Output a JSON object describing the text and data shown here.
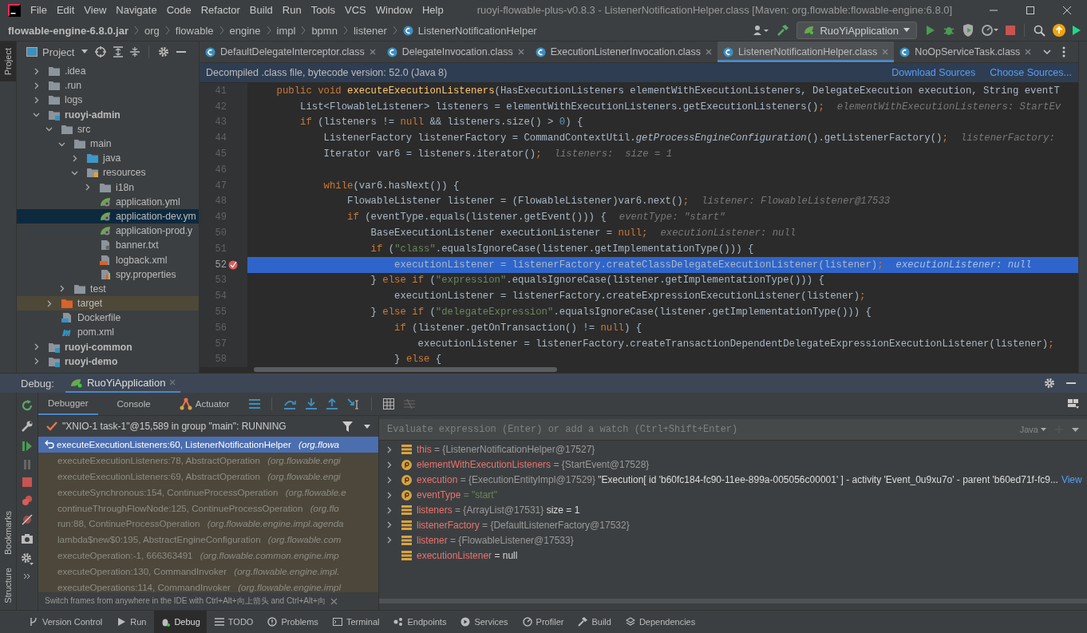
{
  "menu": [
    "File",
    "Edit",
    "View",
    "Navigate",
    "Code",
    "Refactor",
    "Build",
    "Run",
    "Tools",
    "VCS",
    "Window",
    "Help"
  ],
  "window_title": "ruoyi-flowable-plus-v0.8.3 - ListenerNotificationHelper.class [Maven: org.flowable:flowable-engine:6.8.0]",
  "breadcrumbs": [
    "flowable-engine-6.8.0.jar",
    "org",
    "flowable",
    "engine",
    "impl",
    "bpmn",
    "listener",
    "ListenerNotificationHelper"
  ],
  "run_config": "RuoYiApplication",
  "left_stripe": [
    "Project",
    "Bookmarks",
    "Structure"
  ],
  "project": {
    "title": "Project",
    "tree": [
      {
        "label": ".idea",
        "kind": "folder",
        "expanded": false,
        "selected": false
      },
      {
        "label": ".run",
        "kind": "folder",
        "expanded": false,
        "selected": false
      },
      {
        "label": "logs",
        "kind": "folder",
        "expanded": false,
        "selected": false
      },
      {
        "label": "ruoyi-admin",
        "kind": "module",
        "expanded": true,
        "selected": false,
        "children": [
          {
            "label": "src",
            "kind": "folder",
            "expanded": true,
            "selected": false,
            "children": [
              {
                "label": "main",
                "kind": "folder",
                "expanded": true,
                "selected": false,
                "children": [
                  {
                    "label": "java",
                    "kind": "source",
                    "expanded": false,
                    "selected": false
                  },
                  {
                    "label": "resources",
                    "kind": "resources",
                    "expanded": true,
                    "selected": false,
                    "children": [
                      {
                        "label": "i18n",
                        "kind": "folder",
                        "expanded": false,
                        "selected": false
                      },
                      {
                        "label": "application.yml",
                        "kind": "yaml",
                        "selected": false
                      },
                      {
                        "label": "application-dev.ym",
                        "kind": "yaml",
                        "selected": true
                      },
                      {
                        "label": "application-prod.y",
                        "kind": "yaml",
                        "selected": false
                      },
                      {
                        "label": "banner.txt",
                        "kind": "text",
                        "selected": false
                      },
                      {
                        "label": "logback.xml",
                        "kind": "xml",
                        "selected": false
                      },
                      {
                        "label": "spy.properties",
                        "kind": "properties",
                        "selected": false
                      }
                    ]
                  }
                ]
              },
              {
                "label": "test",
                "kind": "folder",
                "expanded": false,
                "selected": false
              }
            ]
          },
          {
            "label": "target",
            "kind": "excluded",
            "expanded": false,
            "selected": false
          },
          {
            "label": "Dockerfile",
            "kind": "docker",
            "selected": false
          },
          {
            "label": "pom.xml",
            "kind": "maven",
            "selected": false
          }
        ]
      },
      {
        "label": "ruoyi-common",
        "kind": "module",
        "expanded": false,
        "selected": false
      },
      {
        "label": "ruoyi-demo",
        "kind": "module",
        "expanded": false,
        "selected": false
      }
    ]
  },
  "editor_tabs": [
    {
      "label": "DefaultDelegateInterceptor.class",
      "selected": false
    },
    {
      "label": "DelegateInvocation.class",
      "selected": false
    },
    {
      "label": "ExecutionListenerInvocation.class",
      "selected": false
    },
    {
      "label": "ListenerNotificationHelper.class",
      "selected": true
    },
    {
      "label": "NoOpServiceTask.class",
      "selected": false
    }
  ],
  "banner": {
    "text": "Decompiled .class file, bytecode version: 52.0 (Java 8)",
    "links": [
      "Download Sources",
      "Choose Sources..."
    ]
  },
  "code_lines": [
    {
      "number": "41",
      "current": false,
      "breakpoint": false,
      "segments": [
        {
          "kind": "keyword",
          "t": "    public void "
        },
        {
          "kind": "declaration",
          "t": "executeExecutionListeners"
        },
        {
          "kind": "plain",
          "t": "(HasExecutionListeners elementWithExecutionListeners, DelegateExecution execution, String eventT"
        }
      ]
    },
    {
      "number": "42",
      "current": false,
      "breakpoint": false,
      "segments": [
        {
          "kind": "plain",
          "t": "        List<FlowableListener> listeners = elementWithExecutionListeners.getExecutionListeners()"
        },
        {
          "kind": "keyword",
          "t": ";"
        },
        {
          "kind": "hint",
          "t": "elementWithExecutionListeners: StartEv"
        }
      ]
    },
    {
      "number": "43",
      "current": false,
      "breakpoint": false,
      "segments": [
        {
          "kind": "keyword",
          "t": "        if"
        },
        {
          "kind": "plain",
          "t": " (listeners != "
        },
        {
          "kind": "keyword",
          "t": "null"
        },
        {
          "kind": "plain",
          "t": " && listeners.size() > "
        },
        {
          "kind": "number",
          "t": "0"
        },
        {
          "kind": "plain",
          "t": ") {"
        }
      ]
    },
    {
      "number": "44",
      "current": false,
      "breakpoint": false,
      "segments": [
        {
          "kind": "plain",
          "t": "            ListenerFactory listenerFactory = CommandContextUtil."
        },
        {
          "kind": "static",
          "t": "getProcessEngineConfiguration"
        },
        {
          "kind": "plain",
          "t": "().getListenerFactory()"
        },
        {
          "kind": "keyword",
          "t": ";"
        },
        {
          "kind": "hint",
          "t": "listenerFactory:"
        }
      ]
    },
    {
      "number": "45",
      "current": false,
      "breakpoint": false,
      "segments": [
        {
          "kind": "plain",
          "t": "            Iterator var6 = listeners.iterator()"
        },
        {
          "kind": "keyword",
          "t": ";"
        },
        {
          "kind": "hint",
          "t": "listeners:  size = 1"
        }
      ]
    },
    {
      "number": "46",
      "current": false,
      "breakpoint": false
    },
    {
      "number": "47",
      "current": false,
      "breakpoint": false,
      "segments": [
        {
          "kind": "keyword",
          "t": "            while"
        },
        {
          "kind": "plain",
          "t": "(var6.hasNext()) {"
        }
      ]
    },
    {
      "number": "48",
      "current": false,
      "breakpoint": false,
      "segments": [
        {
          "kind": "plain",
          "t": "                FlowableListener listener = (FlowableListener)var6.next()"
        },
        {
          "kind": "keyword",
          "t": ";"
        },
        {
          "kind": "hint",
          "t": "listener: FlowableListener@17533"
        }
      ]
    },
    {
      "number": "49",
      "current": false,
      "breakpoint": false,
      "segments": [
        {
          "kind": "keyword",
          "t": "                if"
        },
        {
          "kind": "plain",
          "t": " (eventType.equals(listener.getEvent())) {"
        },
        {
          "kind": "hint",
          "t": "eventType: \"start\""
        }
      ]
    },
    {
      "number": "50",
      "current": false,
      "breakpoint": false,
      "segments": [
        {
          "kind": "plain",
          "t": "                    BaseExecutionListener executionListener = "
        },
        {
          "kind": "keyword",
          "t": "null;"
        },
        {
          "kind": "hint",
          "t": "executionListener: null"
        }
      ]
    },
    {
      "number": "51",
      "current": false,
      "breakpoint": false,
      "segments": [
        {
          "kind": "keyword",
          "t": "                    if"
        },
        {
          "kind": "plain",
          "t": " ("
        },
        {
          "kind": "string",
          "t": "\"class\""
        },
        {
          "kind": "plain",
          "t": ".equalsIgnoreCase(listener.getImplementationType())) {"
        }
      ]
    },
    {
      "number": "52",
      "current": true,
      "breakpoint": true,
      "segments": [
        {
          "kind": "plain",
          "t": "                        executionListener = listenerFactory.createClassDelegateExecutionListener(listener)"
        },
        {
          "kind": "keyword",
          "t": ";"
        },
        {
          "kind": "hint",
          "t": "executionListener: null"
        }
      ]
    },
    {
      "number": "53",
      "current": false,
      "breakpoint": false,
      "segments": [
        {
          "kind": "plain",
          "t": "                    } "
        },
        {
          "kind": "keyword",
          "t": "else if"
        },
        {
          "kind": "plain",
          "t": " ("
        },
        {
          "kind": "string",
          "t": "\"expression\""
        },
        {
          "kind": "plain",
          "t": ".equalsIgnoreCase(listener.getImplementationType())) {"
        }
      ]
    },
    {
      "number": "54",
      "current": false,
      "breakpoint": false,
      "segments": [
        {
          "kind": "plain",
          "t": "                        executionListener = listenerFactory.createExpressionExecutionListener(listener)"
        },
        {
          "kind": "keyword",
          "t": ";"
        }
      ]
    },
    {
      "number": "55",
      "current": false,
      "breakpoint": false,
      "segments": [
        {
          "kind": "plain",
          "t": "                    } "
        },
        {
          "kind": "keyword",
          "t": "else if"
        },
        {
          "kind": "plain",
          "t": " ("
        },
        {
          "kind": "string",
          "t": "\"delegateExpression\""
        },
        {
          "kind": "plain",
          "t": ".equalsIgnoreCase(listener.getImplementationType())) {"
        }
      ]
    },
    {
      "number": "56",
      "current": false,
      "breakpoint": false,
      "segments": [
        {
          "kind": "keyword",
          "t": "                        if"
        },
        {
          "kind": "plain",
          "t": " (listener.getOnTransaction() != "
        },
        {
          "kind": "keyword",
          "t": "null"
        },
        {
          "kind": "plain",
          "t": ") {"
        }
      ]
    },
    {
      "number": "57",
      "current": false,
      "breakpoint": false,
      "segments": [
        {
          "kind": "plain",
          "t": "                            executionListener = listenerFactory.createTransactionDependentDelegateExpressionExecutionListener(listener)"
        },
        {
          "kind": "keyword",
          "t": ";"
        }
      ]
    },
    {
      "number": "58",
      "current": false,
      "breakpoint": false,
      "segments": [
        {
          "kind": "plain",
          "t": "                        } "
        },
        {
          "kind": "keyword",
          "t": "else"
        },
        {
          "kind": "plain",
          "t": " {"
        }
      ]
    }
  ],
  "debug": {
    "title": "Debug:",
    "session": "RuoYiApplication",
    "tabs": [
      {
        "label": "Debugger",
        "selected": true
      },
      {
        "label": "Console",
        "selected": false
      },
      {
        "label": "Actuator",
        "selected": false
      }
    ],
    "thread": "\"XNIO-1 task-1\"@15,589 in group \"main\": RUNNING",
    "frames": [
      {
        "method": "executeExecutionListeners:60, ListenerNotificationHelper",
        "package": "(org.flowa",
        "selected": true
      },
      {
        "method": "executeExecutionListeners:78, AbstractOperation",
        "package": "(org.flowable.engi",
        "selected": false
      },
      {
        "method": "executeExecutionListeners:69, AbstractOperation",
        "package": "(org.flowable.engi",
        "selected": false
      },
      {
        "method": "executeSynchronous:154, ContinueProcessOperation",
        "package": "(org.flowable.e",
        "selected": false
      },
      {
        "method": "continueThroughFlowNode:125, ContinueProcessOperation",
        "package": "(org.flo",
        "selected": false
      },
      {
        "method": "run:88, ContinueProcessOperation",
        "package": "(org.flowable.engine.impl.agenda",
        "selected": false
      },
      {
        "method": "lambda$new$0:195, AbstractEngineConfiguration",
        "package": "(org.flowable.com",
        "selected": false
      },
      {
        "method": "executeOperation:-1, 666363491",
        "package": "(org.flowable.common.engine.imp",
        "selected": false
      },
      {
        "method": "executeOperation:130, CommandInvoker",
        "package": "(org.flowable.engine.impl.",
        "selected": false
      },
      {
        "method": "executeOperations:114, CommandInvoker",
        "package": "(org.flowable.engine.impl",
        "selected": false
      }
    ],
    "hint": "Switch frames from anywhere in the IDE with Ctrl+Alt+向上箭头 and Ctrl+Alt+向",
    "evaluate_placeholder": "Evaluate expression (Enter) or add a watch (Ctrl+Shift+Enter)",
    "language": "Java",
    "variables": [
      {
        "name": "this",
        "kind": "field",
        "expandable": true,
        "value": {
          "kind": "ref",
          "text": "= {ListenerNotificationHelper@17527}"
        }
      },
      {
        "name": "elementWithExecutionListeners",
        "kind": "param",
        "expandable": true,
        "value": {
          "kind": "ref",
          "text": "= {StartEvent@17528}"
        }
      },
      {
        "name": "execution",
        "kind": "param",
        "expandable": true,
        "value": {
          "kind": "ref",
          "text": "= {ExecutionEntityImpl@17529}"
        },
        "extra": "\"Execution[ id 'b60fc184-fc90-11ee-899a-005056c00001' ] - activity 'Event_0u9xu7o' - parent 'b60ed71f-fc9...",
        "link": "View"
      },
      {
        "name": "eventType",
        "kind": "param",
        "expandable": true,
        "value": {
          "kind": "string",
          "text": "= \"start\""
        }
      },
      {
        "name": "listeners",
        "kind": "field",
        "expandable": true,
        "value": {
          "kind": "ref",
          "text": "= {ArrayList@17531}"
        },
        "extra": "size = 1"
      },
      {
        "name": "listenerFactory",
        "kind": "field",
        "expandable": true,
        "value": {
          "kind": "ref",
          "text": "= {DefaultListenerFactory@17532}"
        }
      },
      {
        "name": "listener",
        "kind": "field",
        "expandable": true,
        "value": {
          "kind": "ref",
          "text": "= {FlowableListener@17533}"
        }
      },
      {
        "name": "executionListener",
        "kind": "field",
        "expandable": false,
        "value": {
          "kind": "literal",
          "text": "= null"
        }
      }
    ]
  },
  "tool_windows": [
    {
      "label": "Version Control",
      "selected": false
    },
    {
      "label": "Run",
      "selected": false
    },
    {
      "label": "Debug",
      "selected": true
    },
    {
      "label": "TODO",
      "selected": false
    },
    {
      "label": "Problems",
      "selected": false
    },
    {
      "label": "Terminal",
      "selected": false
    },
    {
      "label": "Endpoints",
      "selected": false
    },
    {
      "label": "Services",
      "selected": false
    },
    {
      "label": "Profiler",
      "selected": false
    },
    {
      "label": "Build",
      "selected": false
    },
    {
      "label": "Dependencies",
      "selected": false
    }
  ]
}
